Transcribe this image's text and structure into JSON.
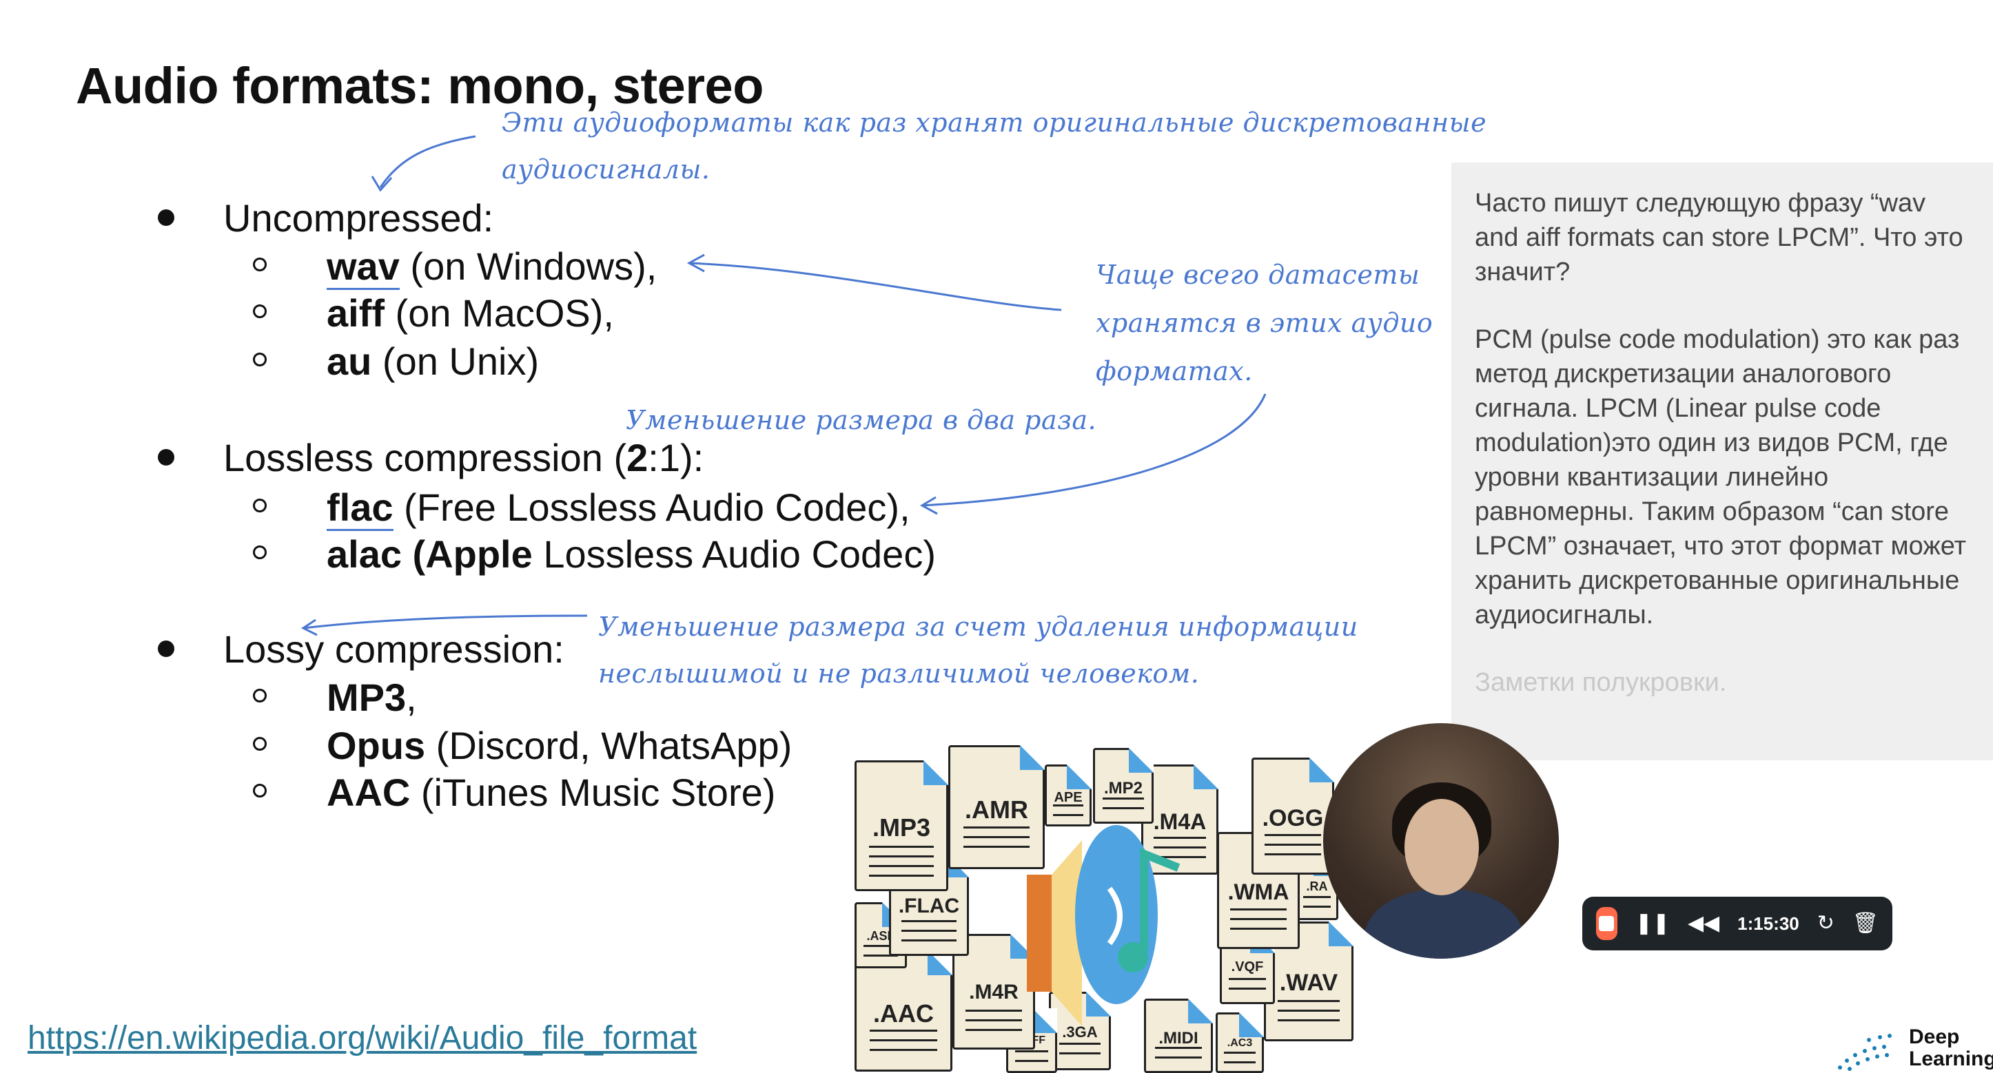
{
  "slide": {
    "title": "Audio formats: mono, stereo",
    "annotations": {
      "top_note_line1": "Эти аудиоформаты как раз хранят оригинальные дискретованные",
      "top_note_line2": "аудиосигналы.",
      "right_note_line1": "Чаще всего датасеты",
      "right_note_line2": "хранятся в этих аудио",
      "right_note_line3": "форматах.",
      "lossless_note": "Уменьшение размера в два раза.",
      "lossy_note_line1": "Уменьшение размера за счет удаления информации",
      "lossy_note_line2": "неслышимой и не различимой человеком."
    },
    "bullets": [
      {
        "label": "Uncompressed:",
        "items": [
          {
            "bold": "wav",
            "rest": " (on Windows),"
          },
          {
            "bold": "aiff",
            "rest": " (on MacOS),"
          },
          {
            "bold": "au",
            "rest": " (on Unix)"
          }
        ]
      },
      {
        "label_prefix": "Lossless compression (",
        "label_bold": "2",
        "label_suffix": ":1):",
        "items": [
          {
            "bold": "flac",
            "rest": " (Free Lossless Audio Codec),"
          },
          {
            "bold": "alac (Apple",
            "rest": " Lossless Audio Codec)"
          }
        ]
      },
      {
        "label": "Lossy compression:",
        "items": [
          {
            "bold": "MP3",
            "rest": ","
          },
          {
            "bold": "Opus",
            "rest": " (Discord, WhatsApp)"
          },
          {
            "bold": "AAC",
            "rest": " (iTunes Music Store)"
          }
        ]
      }
    ],
    "link": "https://en.wikipedia.org/wiki/Audio_file_format",
    "file_icons": [
      ".MP3",
      ".AMR",
      "APE",
      ".MP2",
      ".M4A",
      ".OGG",
      ".FLAC",
      ".ASF",
      ".WMA",
      ".RA",
      ".AAC",
      ".M4R",
      ".VQF",
      ".WAV",
      ".AIFF",
      ".3GA",
      ".MIDI",
      ".AC3"
    ]
  },
  "notes_panel": {
    "paragraph1": "Часто пишут следующую фразу “wav and aiff formats can store LPCM”.  Что это значит?",
    "paragraph2": "PCM (pulse code modulation) это как раз метод дискретизации аналогового сигнала. LPCM  (Linear pulse code modulation)это один из видов PCM, где уровни квантизации линейно равномерны. Таким образом “can store LPCM”  означает, что этот формат может хранить дискретованные оригинальные аудиосигналы.",
    "placeholder": "Заметки полукровки."
  },
  "recorder": {
    "time": "1:15:30",
    "stop_icon": "stop-icon",
    "pause_icon": "pause-icon",
    "rewind_icon": "rewind-icon",
    "restart_icon": "restart-icon",
    "delete_icon": "trash-icon"
  },
  "logo": {
    "line1": "Deep",
    "line2": "Learning"
  },
  "colors": {
    "annotation_blue": "#4a78d0",
    "link": "#2a7a9a",
    "notes_bg": "#efefef",
    "recorder_stop": "#ff6a4a"
  }
}
